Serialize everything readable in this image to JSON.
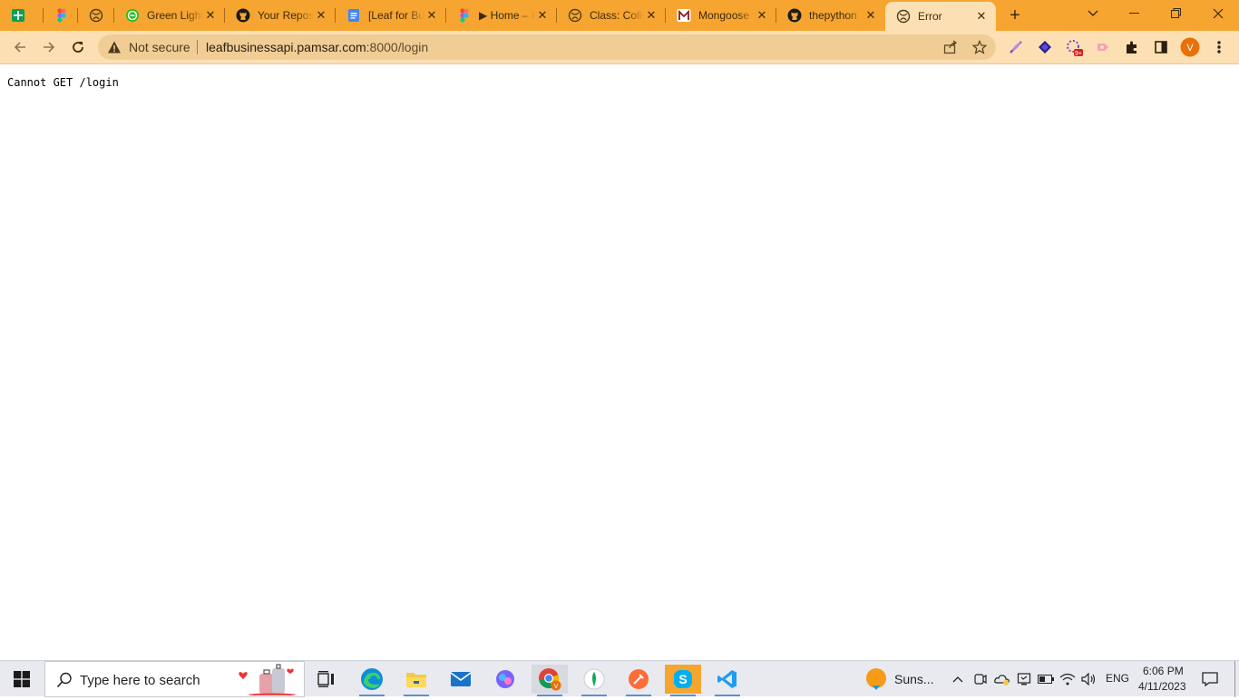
{
  "browser": {
    "tabs": [
      {
        "title": "",
        "icon": "google-sheets-icon"
      },
      {
        "title": "",
        "icon": "figma-icon"
      },
      {
        "title": "",
        "icon": "globe-icon"
      },
      {
        "title": "Green Light",
        "icon": "green-light-icon"
      },
      {
        "title": "Your Repositories",
        "icon": "github-icon"
      },
      {
        "title": "[Leaf for Business",
        "icon": "google-docs-icon"
      },
      {
        "title": "▶ Home – Figma",
        "icon": "figma-icon"
      },
      {
        "title": "Class: Collection",
        "icon": "globe-icon"
      },
      {
        "title": "Mongoose",
        "icon": "mongoose-icon"
      },
      {
        "title": "thepython",
        "icon": "github-icon"
      },
      {
        "title": "Error",
        "icon": "globe-icon"
      }
    ],
    "active_tab": 10,
    "security_label": "Not secure",
    "url": {
      "host": "leafbusinessapi.pamsar.com",
      "rest": ":8000/login"
    },
    "profile_initial": "V",
    "extension_badge": "9+",
    "accent": "#f7a531"
  },
  "page": {
    "message": "Cannot GET /login"
  },
  "taskbar": {
    "search_placeholder": "Type here to search",
    "weather": "Suns...",
    "language": "ENG",
    "time": "6:06 PM",
    "date": "4/11/2023"
  }
}
